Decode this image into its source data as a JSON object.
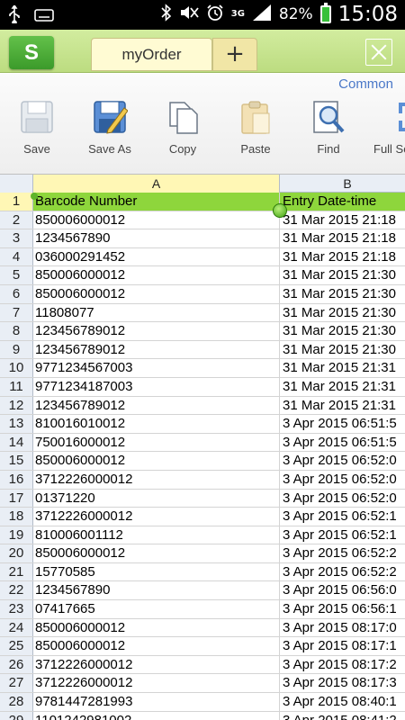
{
  "status_bar": {
    "battery_percent": "82%",
    "network": "3G",
    "time": "15:08",
    "icons": [
      "usb-icon",
      "keyboard-icon",
      "bluetooth-icon",
      "mute-icon",
      "alarm-icon",
      "signal-icon",
      "battery-charging-icon"
    ]
  },
  "title_bar": {
    "app_logo": "S",
    "tab_label": "myOrder",
    "add_label": "+",
    "close_icon": "close-icon"
  },
  "ribbon": {
    "section_label": "Common",
    "tools": [
      {
        "label": "Save",
        "icon": "save-icon"
      },
      {
        "label": "Save As",
        "icon": "save-as-icon"
      },
      {
        "label": "Copy",
        "icon": "copy-icon"
      },
      {
        "label": "Paste",
        "icon": "paste-icon"
      },
      {
        "label": "Find",
        "icon": "find-icon"
      },
      {
        "label": "Full Sc",
        "icon": "full-screen-icon"
      }
    ]
  },
  "sheet": {
    "columns": [
      "A",
      "B"
    ],
    "header_row": {
      "number": "1",
      "col_a": "Barcode Number",
      "col_b": "Entry Date-time"
    },
    "rows": [
      {
        "n": "2",
        "a": "850006000012",
        "b": "31 Mar 2015 21:18"
      },
      {
        "n": "3",
        "a": "1234567890",
        "b": "31 Mar 2015 21:18"
      },
      {
        "n": "4",
        "a": "036000291452",
        "b": "31 Mar 2015 21:18"
      },
      {
        "n": "5",
        "a": "850006000012",
        "b": "31 Mar 2015 21:30"
      },
      {
        "n": "6",
        "a": "850006000012",
        "b": "31 Mar 2015 21:30"
      },
      {
        "n": "7",
        "a": "11808077",
        "b": "31 Mar 2015 21:30"
      },
      {
        "n": "8",
        "a": "123456789012",
        "b": "31 Mar 2015 21:30"
      },
      {
        "n": "9",
        "a": "123456789012",
        "b": "31 Mar 2015 21:30"
      },
      {
        "n": "10",
        "a": "9771234567003",
        "b": "31 Mar 2015 21:31"
      },
      {
        "n": "11",
        "a": "9771234187003",
        "b": "31 Mar 2015 21:31"
      },
      {
        "n": "12",
        "a": "123456789012",
        "b": "31 Mar 2015 21:31"
      },
      {
        "n": "13",
        "a": "810016010012",
        "b": "3 Apr 2015 06:51:5"
      },
      {
        "n": "14",
        "a": "750016000012",
        "b": "3 Apr 2015 06:51:5"
      },
      {
        "n": "15",
        "a": "850006000012",
        "b": "3 Apr 2015 06:52:0"
      },
      {
        "n": "16",
        "a": "3712226000012",
        "b": "3 Apr 2015 06:52:0"
      },
      {
        "n": "17",
        "a": "01371220",
        "b": "3 Apr 2015 06:52:0"
      },
      {
        "n": "18",
        "a": "3712226000012",
        "b": "3 Apr 2015 06:52:1"
      },
      {
        "n": "19",
        "a": "810006001112",
        "b": "3 Apr 2015 06:52:1"
      },
      {
        "n": "20",
        "a": "850006000012",
        "b": "3 Apr 2015 06:52:2"
      },
      {
        "n": "21",
        "a": "15770585",
        "b": "3 Apr 2015 06:52:2"
      },
      {
        "n": "22",
        "a": "1234567890",
        "b": "3 Apr 2015 06:56:0"
      },
      {
        "n": "23",
        "a": "07417665",
        "b": "3 Apr 2015 06:56:1"
      },
      {
        "n": "24",
        "a": "850006000012",
        "b": "3 Apr 2015 08:17:0"
      },
      {
        "n": "25",
        "a": "850006000012",
        "b": "3 Apr 2015 08:17:1"
      },
      {
        "n": "26",
        "a": "3712226000012",
        "b": "3 Apr 2015 08:17:2"
      },
      {
        "n": "27",
        "a": "3712226000012",
        "b": "3 Apr 2015 08:17:3"
      },
      {
        "n": "28",
        "a": "9781447281993",
        "b": "3 Apr 2015 08:40:1"
      },
      {
        "n": "29",
        "a": "1101242981002",
        "b": "3 Apr 2015 08:41:2"
      }
    ]
  },
  "colors": {
    "header_green": "#8ed63c",
    "selected_yellow": "#fff7b5",
    "titlebar_green": "#c5e38c",
    "ribbon_label_blue": "#4a78c8"
  }
}
